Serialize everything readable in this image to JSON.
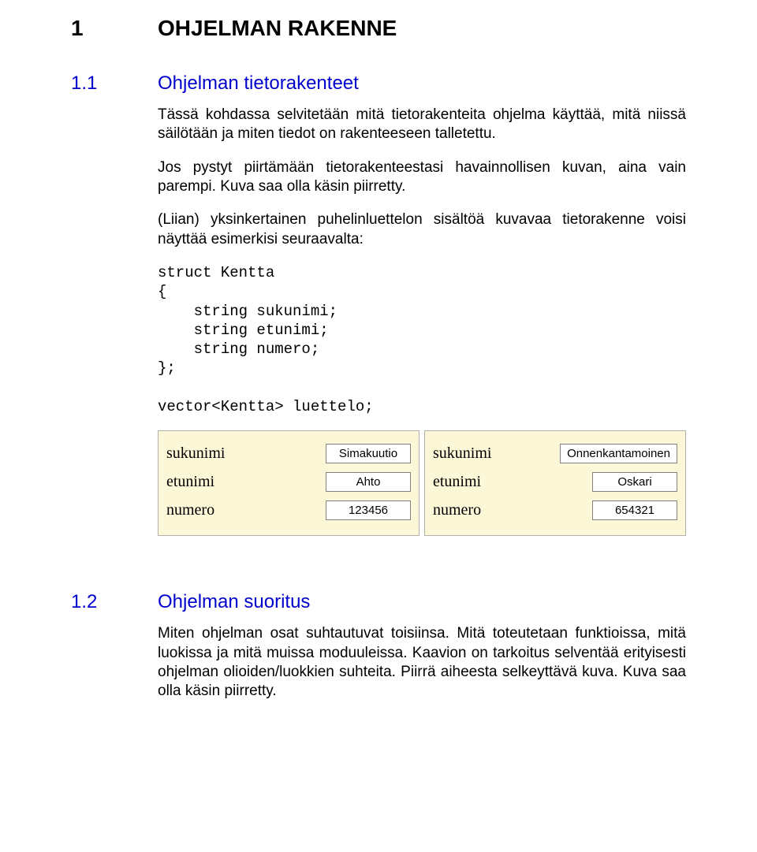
{
  "chapter": {
    "number": "1",
    "title": "OHJELMAN RAKENNE"
  },
  "section1": {
    "number": "1.1",
    "title": "Ohjelman tietorakenteet",
    "para1": "Tässä kohdassa selvitetään mitä tietorakenteita ohjelma käyttää, mitä niissä säilötään ja miten tiedot on rakenteeseen talletettu.",
    "para2": "Jos pystyt piirtämään tietorakenteestasi havainnollisen kuvan, aina vain parempi. Kuva saa olla käsin piirretty.",
    "para3": "(Liian) yksinkertainen puhelinluettelon sisältöä kuvavaa tietorakenne voisi näyttää esimerkisi seuraavalta:",
    "code": "struct Kentta\n{\n    string sukunimi;\n    string etunimi;\n    string numero;\n};\n\nvector<Kentta> luettelo;"
  },
  "diagram": {
    "labels": {
      "sukunimi": "sukunimi",
      "etunimi": "etunimi",
      "numero": "numero"
    },
    "cards": [
      {
        "sukunimi": "Simakuutio",
        "etunimi": "Ahto",
        "numero": "123456"
      },
      {
        "sukunimi": "Onnenkantamoinen",
        "etunimi": "Oskari",
        "numero": "654321"
      }
    ]
  },
  "section2": {
    "number": "1.2",
    "title": "Ohjelman suoritus",
    "para1": "Miten ohjelman osat suhtautuvat toisiinsa. Mitä toteutetaan funktioissa, mitä luokissa ja mitä muissa moduuleissa. Kaavion on tarkoitus selventää erityisesti ohjelman olioiden/luokkien suhteita. Piirrä aiheesta selkeyttävä kuva. Kuva saa olla käsin piirretty."
  }
}
